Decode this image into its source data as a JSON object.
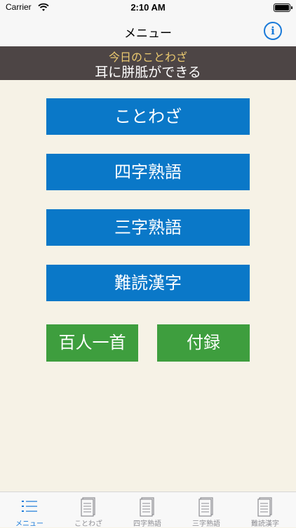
{
  "status": {
    "carrier": "Carrier",
    "time": "2:10 AM"
  },
  "nav": {
    "title": "メニュー"
  },
  "banner": {
    "heading": "今日のことわざ",
    "proverb": "耳に胼胝ができる"
  },
  "menu": {
    "kotowaza": "ことわざ",
    "yoji": "四字熟語",
    "sanji": "三字熟語",
    "nandoku": "難読漢字",
    "hyakunin": "百人一首",
    "furoku": "付録"
  },
  "colors": {
    "blue_button": "#0a78c8",
    "green_button": "#3e9e3e",
    "banner_bg": "#4d4545",
    "banner_heading": "#eac970",
    "accent": "#1a7ad9"
  },
  "tabs": [
    {
      "label": "メニュー",
      "icon": "list-icon",
      "active": true
    },
    {
      "label": "ことわざ",
      "icon": "document-icon",
      "active": false
    },
    {
      "label": "四字熟語",
      "icon": "document-icon",
      "active": false
    },
    {
      "label": "三字熟語",
      "icon": "document-icon",
      "active": false
    },
    {
      "label": "難読漢字",
      "icon": "document-icon",
      "active": false
    }
  ]
}
